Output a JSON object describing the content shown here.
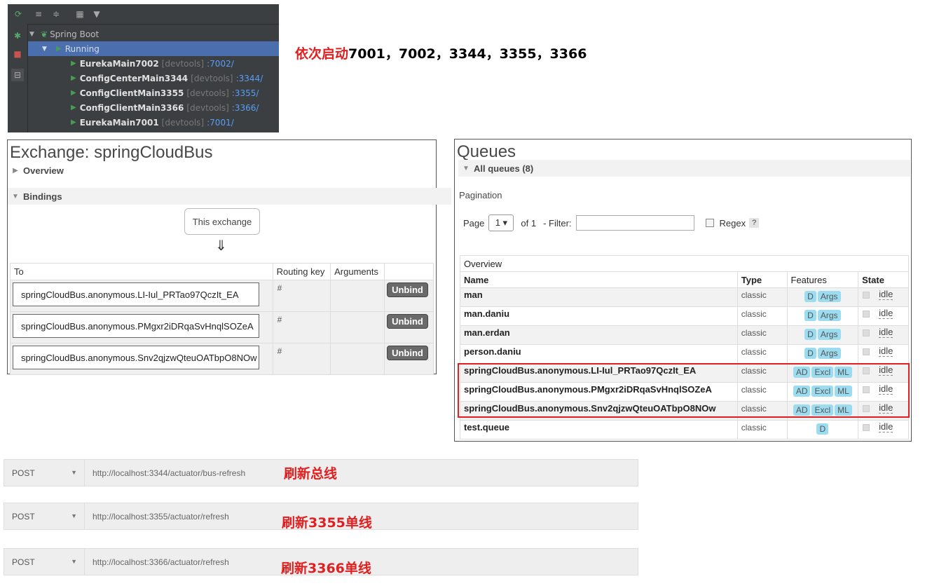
{
  "ide": {
    "tree": {
      "root": "Spring Boot",
      "group": "Running",
      "services": [
        {
          "name": "EurekaMain7002",
          "tag": "[devtools]",
          "port": ":7002/"
        },
        {
          "name": "ConfigCenterMain3344",
          "tag": "[devtools]",
          "port": ":3344/"
        },
        {
          "name": "ConfigClientMain3355",
          "tag": "[devtools]",
          "port": ":3355/"
        },
        {
          "name": "ConfigClientMain3366",
          "tag": "[devtools]",
          "port": ":3366/"
        },
        {
          "name": "EurekaMain7001",
          "tag": "[devtools]",
          "port": ":7001/"
        }
      ]
    },
    "note_red": "依次启动",
    "note_black": "7001，7002，3344，3355，3366"
  },
  "exchange": {
    "title": "Exchange: springCloudBus",
    "overview": "Overview",
    "bindings": "Bindings",
    "this_exchange": "This exchange",
    "down_arrow": "⇓",
    "headers": {
      "to": "To",
      "routing_key": "Routing key",
      "arguments": "Arguments"
    },
    "rows": [
      {
        "queue": "springCloudBus.anonymous.LI-Iul_PRTao97QczIt_EA",
        "key": "#",
        "action": "Unbind"
      },
      {
        "queue": "springCloudBus.anonymous.PMgxr2iDRqaSvHnqlSOZeA",
        "key": "#",
        "action": "Unbind"
      },
      {
        "queue": "springCloudBus.anonymous.Snv2qjzwQteuOATbpO8NOw",
        "key": "#",
        "action": "Unbind"
      }
    ]
  },
  "queues": {
    "title": "Queues",
    "all_queues": "All queues (8)",
    "pagination": "Pagination",
    "page_label": "Page",
    "page_value": "1 ▾",
    "of_label": "of 1",
    "filter_label": "- Filter:",
    "regex_label": "Regex",
    "help": "?",
    "overview_header": "Overview",
    "headers": {
      "name": "Name",
      "type": "Type",
      "features": "Features",
      "state": "State"
    },
    "rows": [
      {
        "name": "man",
        "type": "classic",
        "features": [
          "D",
          "Args"
        ],
        "state": "idle"
      },
      {
        "name": "man.daniu",
        "type": "classic",
        "features": [
          "D",
          "Args"
        ],
        "state": "idle"
      },
      {
        "name": "man.erdan",
        "type": "classic",
        "features": [
          "D",
          "Args"
        ],
        "state": "idle"
      },
      {
        "name": "person.daniu",
        "type": "classic",
        "features": [
          "D",
          "Args"
        ],
        "state": "idle"
      },
      {
        "name": "springCloudBus.anonymous.LI-Iul_PRTao97QczIt_EA",
        "type": "classic",
        "features": [
          "AD",
          "Excl",
          "ML"
        ],
        "state": "idle"
      },
      {
        "name": "springCloudBus.anonymous.PMgxr2iDRqaSvHnqlSOZeA",
        "type": "classic",
        "features": [
          "AD",
          "Excl",
          "ML"
        ],
        "state": "idle"
      },
      {
        "name": "springCloudBus.anonymous.Snv2qjzwQteuOATbpO8NOw",
        "type": "classic",
        "features": [
          "AD",
          "Excl",
          "ML"
        ],
        "state": "idle"
      },
      {
        "name": "test.queue",
        "type": "classic",
        "features": [
          "D"
        ],
        "state": "idle"
      }
    ]
  },
  "requests": [
    {
      "method": "POST",
      "url": "http://localhost:3344/actuator/bus-refresh",
      "note": "刷新总线"
    },
    {
      "method": "POST",
      "url": "http://localhost:3355/actuator/refresh",
      "note": "刷新3355单线"
    },
    {
      "method": "POST",
      "url": "http://localhost:3366/actuator/refresh",
      "note": "刷新3366单线"
    }
  ],
  "colors": {
    "highlight": "#e02020",
    "feature_tag": "#9cdcf0",
    "ide_selection": "#4b6eaf",
    "run_green": "#499c54"
  }
}
